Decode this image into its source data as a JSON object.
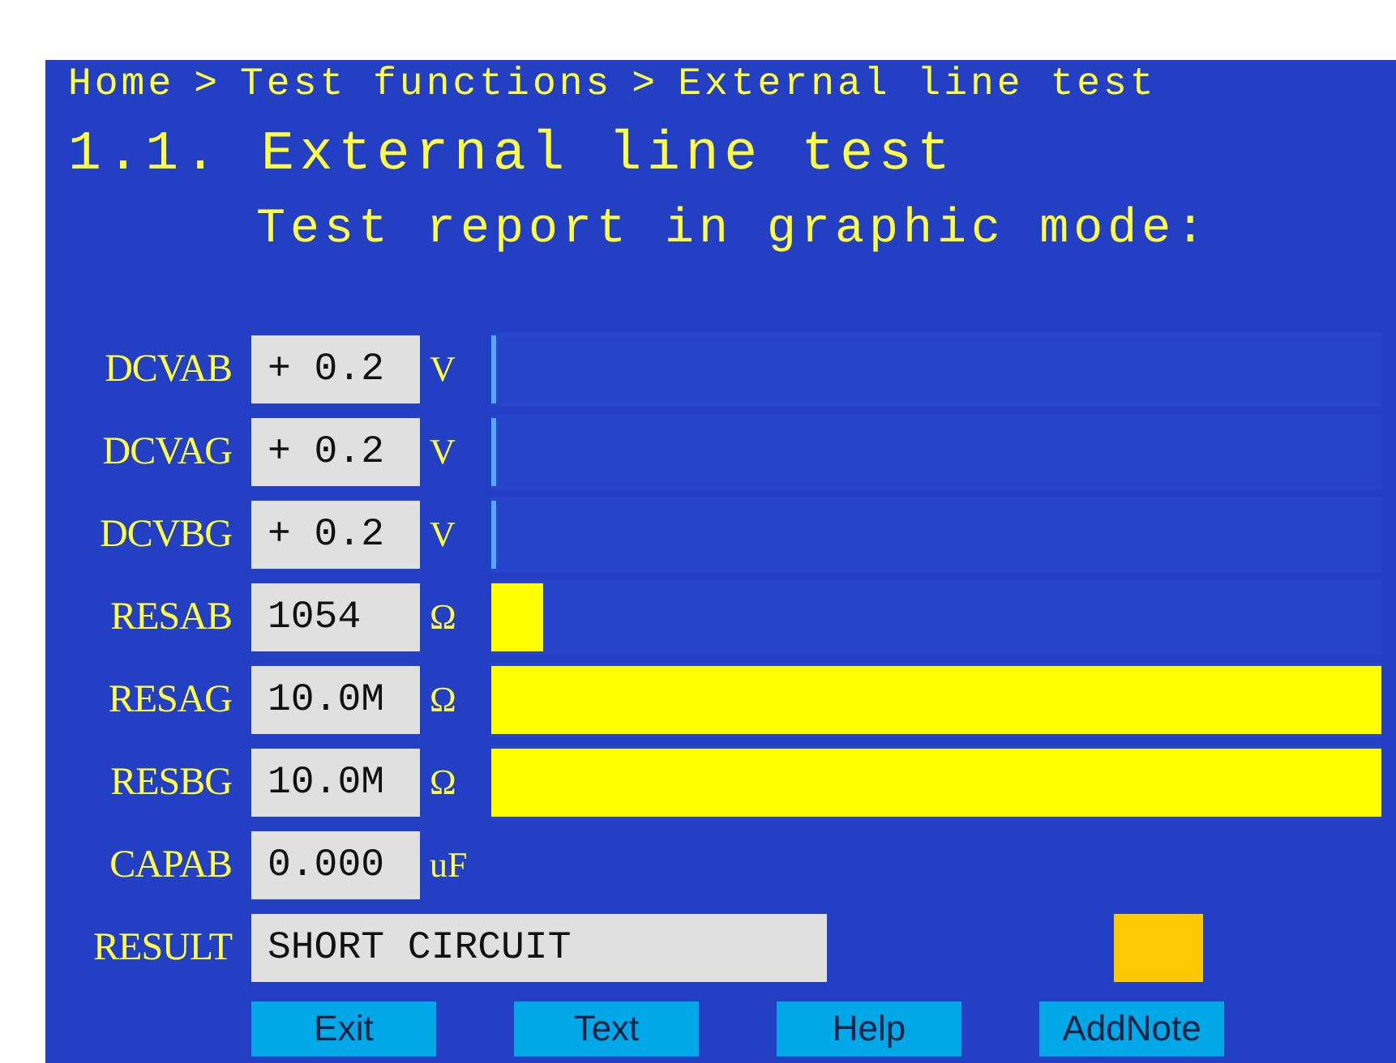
{
  "breadcrumb": [
    "Home",
    "Test functions",
    "External line test"
  ],
  "breadcrumb_separator": ">",
  "title": "1.1. External line test",
  "subtitle": "Test report in graphic mode:",
  "measurements": [
    {
      "label": "DCVAB",
      "value": "+ 0.2",
      "unit": "V",
      "kind": "voltage",
      "level": 0.005
    },
    {
      "label": "DCVAG",
      "value": "+ 0.2",
      "unit": "V",
      "kind": "voltage",
      "level": 0.005
    },
    {
      "label": "DCVBG",
      "value": "+ 0.2",
      "unit": "V",
      "kind": "voltage",
      "level": 0.005
    },
    {
      "label": "RESAB",
      "value": "1054",
      "unit": "Ω",
      "kind": "resistance",
      "level": 0.058
    },
    {
      "label": "RESAG",
      "value": "10.0M",
      "unit": "Ω",
      "kind": "resistance",
      "level": 1
    },
    {
      "label": "RESBG",
      "value": "10.0M",
      "unit": "Ω",
      "kind": "resistance",
      "level": 1
    },
    {
      "label": "CAPAB",
      "value": "0.000",
      "unit": "uF"
    }
  ],
  "result": {
    "label": "RESULT",
    "value": "SHORT CIRCUIT",
    "color": "#ffc800"
  },
  "buttons": [
    "Exit",
    "Text",
    "Help",
    "AddNote"
  ]
}
